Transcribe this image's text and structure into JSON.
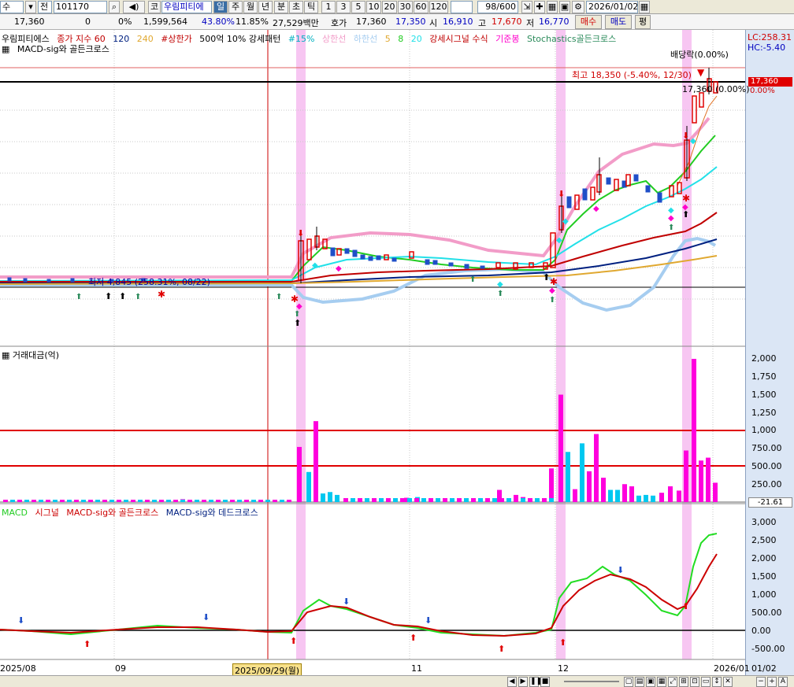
{
  "toolbar": {
    "market": "수",
    "code": "101170",
    "name_btn": "코",
    "stock_name": "우림피티에",
    "periods": [
      "일",
      "주",
      "월",
      "년",
      "분",
      "초",
      "틱"
    ],
    "numbers": [
      "1",
      "3",
      "5",
      "10",
      "20",
      "30",
      "60",
      "120"
    ],
    "count": "98/600",
    "date": "2026/01/02"
  },
  "quote": {
    "price": "17,360",
    "change": "0",
    "change_pct": "0%",
    "volume": "1,599,564",
    "pct1": "43.80%",
    "pct2": "11.85%",
    "amount": "27,529백만",
    "hoga_label": "호가",
    "hoga": "17,360",
    "hoga2": "17,350",
    "open_label": "시",
    "open": "16,910",
    "high_label": "고",
    "high": "17,670",
    "low_label": "저",
    "low": "16,770",
    "buy_btn": "매수",
    "sell_btn": "매도",
    "eval_btn": "평"
  },
  "legend": {
    "items": [
      "우림피티에스",
      "종가 지수 60",
      "120",
      "240",
      "#상한가",
      "500억 10% 강세패턴",
      "#15%",
      "상한선",
      "하한선",
      "5",
      "8",
      "20",
      "강세시그널 수식",
      "기준봉",
      "Stochastics골든크로스"
    ],
    "line2": "MACD-sig와 골든크로스",
    "lc": "LC:258.31",
    "hc": "HC:-5.40"
  },
  "price_panel": {
    "dividend": "배당락(0.00%)",
    "high_annot": "최고 18,350 (-5.40%, 12/30)",
    "last_annot": "17,360 (0.00%)",
    "low_annot": "최저 4,845 (258.31%, 08/22)",
    "last_price_tag": "17,360",
    "last_pct_tag": "0.00%"
  },
  "volume_panel": {
    "title": "거래대금(억)",
    "yticks": [
      "2,000",
      "1,750",
      "1,500",
      "1,250",
      "1,000",
      "750.00",
      "500.00",
      "250.00"
    ],
    "last_tag": "-21.61"
  },
  "macd_panel": {
    "legend": [
      "MACD",
      "시그널",
      "MACD-sig와 골든크로스",
      "MACD-sig와 데드크로스"
    ],
    "yticks": [
      "3,000",
      "2,500",
      "2,000",
      "1,500",
      "1,000",
      "500.00",
      "0.00",
      "-500.00"
    ]
  },
  "xaxis": {
    "labels": [
      "2025/08",
      "09",
      "2025/09/29(월)",
      "11",
      "12",
      "2026/01",
      "01/02"
    ]
  },
  "colors": {
    "up": "#e00000",
    "down": "#1f4fc8",
    "highlight": "#f7c6f2",
    "vol_up": "#ff00dd",
    "vol_down": "#00c8f0",
    "macd": "#22dd22",
    "signal": "#cc0000"
  },
  "chart_data": {
    "type": "candlestick",
    "volume_bars": [
      {
        "x": 380,
        "v": 770,
        "c": "up"
      },
      {
        "x": 392,
        "v": 420,
        "c": "down"
      },
      {
        "x": 401,
        "v": 1130,
        "c": "up"
      },
      {
        "x": 410,
        "v": 120,
        "c": "down"
      },
      {
        "x": 419,
        "v": 140,
        "c": "down"
      },
      {
        "x": 428,
        "v": 100,
        "c": "down"
      },
      {
        "x": 700,
        "v": 470,
        "c": "up"
      },
      {
        "x": 712,
        "v": 1500,
        "c": "up"
      },
      {
        "x": 721,
        "v": 700,
        "c": "down"
      },
      {
        "x": 730,
        "v": 180,
        "c": "up"
      },
      {
        "x": 739,
        "v": 820,
        "c": "down"
      },
      {
        "x": 748,
        "v": 430,
        "c": "up"
      },
      {
        "x": 757,
        "v": 950,
        "c": "up"
      },
      {
        "x": 766,
        "v": 340,
        "c": "up"
      },
      {
        "x": 775,
        "v": 170,
        "c": "down"
      },
      {
        "x": 784,
        "v": 170,
        "c": "down"
      },
      {
        "x": 793,
        "v": 250,
        "c": "up"
      },
      {
        "x": 802,
        "v": 220,
        "c": "up"
      },
      {
        "x": 811,
        "v": 90,
        "c": "down"
      },
      {
        "x": 820,
        "v": 100,
        "c": "down"
      },
      {
        "x": 829,
        "v": 90,
        "c": "down"
      },
      {
        "x": 840,
        "v": 130,
        "c": "up"
      },
      {
        "x": 851,
        "v": 220,
        "c": "up"
      },
      {
        "x": 862,
        "v": 160,
        "c": "up"
      },
      {
        "x": 871,
        "v": 720,
        "c": "up"
      },
      {
        "x": 881,
        "v": 2000,
        "c": "up"
      },
      {
        "x": 890,
        "v": 580,
        "c": "up"
      },
      {
        "x": 899,
        "v": 620,
        "c": "up"
      },
      {
        "x": 908,
        "v": 270,
        "c": "up"
      },
      {
        "x": 634,
        "v": 170,
        "c": "up"
      },
      {
        "x": 655,
        "v": 100,
        "c": "up"
      },
      {
        "x": 664,
        "v": 70,
        "c": "up"
      },
      {
        "x": 516,
        "v": 60,
        "c": "up"
      },
      {
        "x": 530,
        "v": 70,
        "c": "down"
      },
      {
        "x": 232,
        "v": 40,
        "c": "up"
      }
    ]
  }
}
